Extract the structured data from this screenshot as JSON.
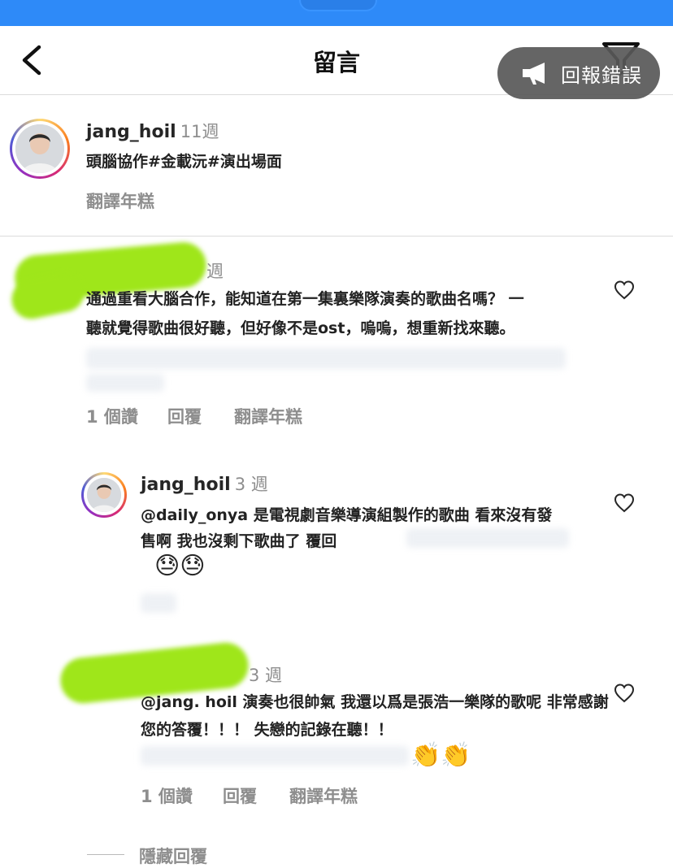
{
  "header": {
    "title": "留言",
    "toast": "回報錯誤",
    "icons": {
      "back": "chevron-left-icon",
      "filter": "filter-icon",
      "report": "megaphone-icon"
    }
  },
  "post": {
    "username": "jang_hoil",
    "time": "11週",
    "caption": "頭腦協作#金載沅#演出場面",
    "translate": "翻譯年糕"
  },
  "comment1": {
    "time": "週",
    "lines": [
      "通過重看大腦合作，能知道在第一集裏樂隊演奏的歌曲名嗎？ 一",
      "聽就覺得歌曲很好聽，但好像不是ost，嗚嗚，想重新找來聽。"
    ],
    "likes": "1 個讚",
    "reply": "回覆",
    "translate": "翻譯年糕"
  },
  "reply1": {
    "username": "jang_hoil",
    "time": "3 週",
    "lines": [
      "@daily_onya 是電視劇音樂導演組製作的歌曲 看來沒有發",
      "售啊 我也沒剩下歌曲了 覆回"
    ],
    "emoji": "😓😓"
  },
  "reply2": {
    "time": "3 週",
    "lines": [
      "@jang. hoil 演奏也很帥氣 我還以爲是張浩一樂隊的歌呢 非常感謝",
      "您的答覆！！！ 失戀的記錄在聽！！"
    ],
    "emoji": "👏👏",
    "likes": "1 個讚",
    "reply": "回覆",
    "translate": "翻譯年糕"
  },
  "hide_replies": "隱藏回覆",
  "colors": {
    "status_bar": "#2e8af8",
    "highlight_scribble": "#9fe61a",
    "secondary_text": "#8e8e8e"
  }
}
